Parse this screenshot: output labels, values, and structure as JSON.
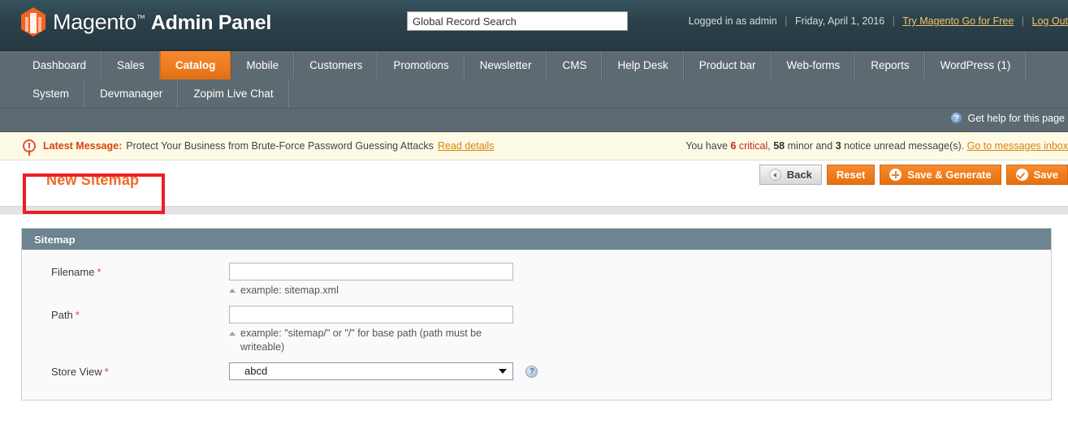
{
  "header": {
    "logo_text_light": "Magento",
    "logo_tm": "™",
    "logo_text_bold": "Admin Panel",
    "search_placeholder": "Global Record Search",
    "search_value": "Global Record Search",
    "logged_in_as": "Logged in as admin",
    "date": "Friday, April 1, 2016",
    "try_magento_link": "Try Magento Go for Free",
    "logout_link": "Log Out",
    "separator": "|"
  },
  "nav": {
    "row1": [
      {
        "label": "Dashboard",
        "active": false
      },
      {
        "label": "Sales",
        "active": false
      },
      {
        "label": "Catalog",
        "active": true
      },
      {
        "label": "Mobile",
        "active": false
      },
      {
        "label": "Customers",
        "active": false
      },
      {
        "label": "Promotions",
        "active": false
      },
      {
        "label": "Newsletter",
        "active": false
      },
      {
        "label": "CMS",
        "active": false
      },
      {
        "label": "Help Desk",
        "active": false
      },
      {
        "label": "Product bar",
        "active": false
      },
      {
        "label": "Web-forms",
        "active": false
      },
      {
        "label": "Reports",
        "active": false
      },
      {
        "label": "WordPress (1)",
        "active": false
      }
    ],
    "row2": [
      {
        "label": "System",
        "active": false
      },
      {
        "label": "Devmanager",
        "active": false
      },
      {
        "label": "Zopim Live Chat",
        "active": false
      }
    ],
    "help_label": "Get help for this page",
    "help_icon_glyph": "?"
  },
  "message_bar": {
    "label": "Latest Message:",
    "text": "Protect Your Business from Brute-Force Password Guessing Attacks",
    "read_details": "Read details",
    "right_prefix": "You have",
    "critical_count": "6",
    "critical_word": "critical,",
    "minor_count": "58",
    "minor_word": "minor and",
    "notice_count": "3",
    "notice_word": "notice unread message(s).",
    "inbox_link": "Go to messages inbox"
  },
  "page": {
    "title": "New Sitemap",
    "buttons": [
      {
        "label": "Back",
        "icon": "back-arrow-icon",
        "style": "gray"
      },
      {
        "label": "Reset",
        "icon": "",
        "style": "orange"
      },
      {
        "label": "Save & Generate",
        "icon": "plus-icon",
        "style": "orange"
      },
      {
        "label": "Save",
        "icon": "check-icon",
        "style": "orange"
      }
    ]
  },
  "panel": {
    "heading": "Sitemap",
    "fields": {
      "filename": {
        "label": "Filename",
        "required_marker": "*",
        "value": "",
        "hint": "example: sitemap.xml"
      },
      "path": {
        "label": "Path",
        "required_marker": "*",
        "value": "",
        "hint": "example: \"sitemap/\" or \"/\" for base path (path must be writeable)"
      },
      "store_view": {
        "label": "Store View",
        "required_marker": "*",
        "selected": "abcd",
        "help_glyph": "?"
      }
    }
  },
  "colors": {
    "header_bg": "#2b4049",
    "nav_bg": "#5e6a71",
    "accent_orange": "#f07d1e",
    "panel_head": "#6d8592",
    "highlight_red": "#ee1d23",
    "title_orange": "#f3682a",
    "message_bg": "#fdfae5",
    "critical_red": "#c4271b"
  }
}
